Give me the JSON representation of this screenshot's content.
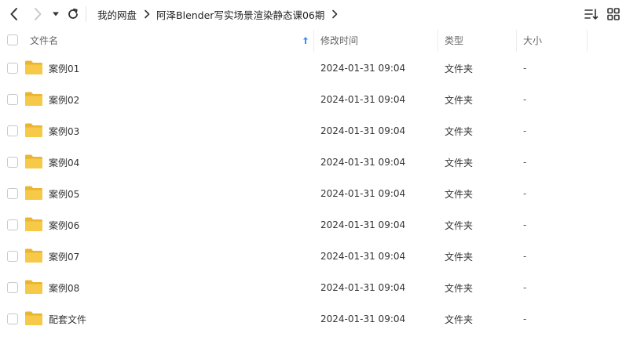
{
  "breadcrumb": {
    "root": "我的网盘",
    "current": "阿泽Blender写实场景渲染静态课06期"
  },
  "header": {
    "name": "文件名",
    "modified": "修改时间",
    "type": "类型",
    "size": "大小"
  },
  "files": [
    {
      "name": "案例01",
      "modified": "2024-01-31 09:04",
      "type": "文件夹",
      "size": "-"
    },
    {
      "name": "案例02",
      "modified": "2024-01-31 09:04",
      "type": "文件夹",
      "size": "-"
    },
    {
      "name": "案例03",
      "modified": "2024-01-31 09:04",
      "type": "文件夹",
      "size": "-"
    },
    {
      "name": "案例04",
      "modified": "2024-01-31 09:04",
      "type": "文件夹",
      "size": "-"
    },
    {
      "name": "案例05",
      "modified": "2024-01-31 09:04",
      "type": "文件夹",
      "size": "-"
    },
    {
      "name": "案例06",
      "modified": "2024-01-31 09:04",
      "type": "文件夹",
      "size": "-"
    },
    {
      "name": "案例07",
      "modified": "2024-01-31 09:04",
      "type": "文件夹",
      "size": "-"
    },
    {
      "name": "案例08",
      "modified": "2024-01-31 09:04",
      "type": "文件夹",
      "size": "-"
    },
    {
      "name": "配套文件",
      "modified": "2024-01-31 09:04",
      "type": "文件夹",
      "size": "-"
    }
  ],
  "colors": {
    "accent": "#3b8ef5",
    "folder": "#f7c948",
    "folder_back": "#eab530"
  },
  "icons": {
    "back": "chevron-left-icon",
    "forward": "chevron-right-icon",
    "dropdown": "caret-down-icon",
    "refresh": "refresh-icon",
    "sort": "sort-list-icon",
    "grid": "grid-view-icon",
    "sort_indicator": "sort-up-arrow-icon",
    "folder": "folder-icon"
  }
}
